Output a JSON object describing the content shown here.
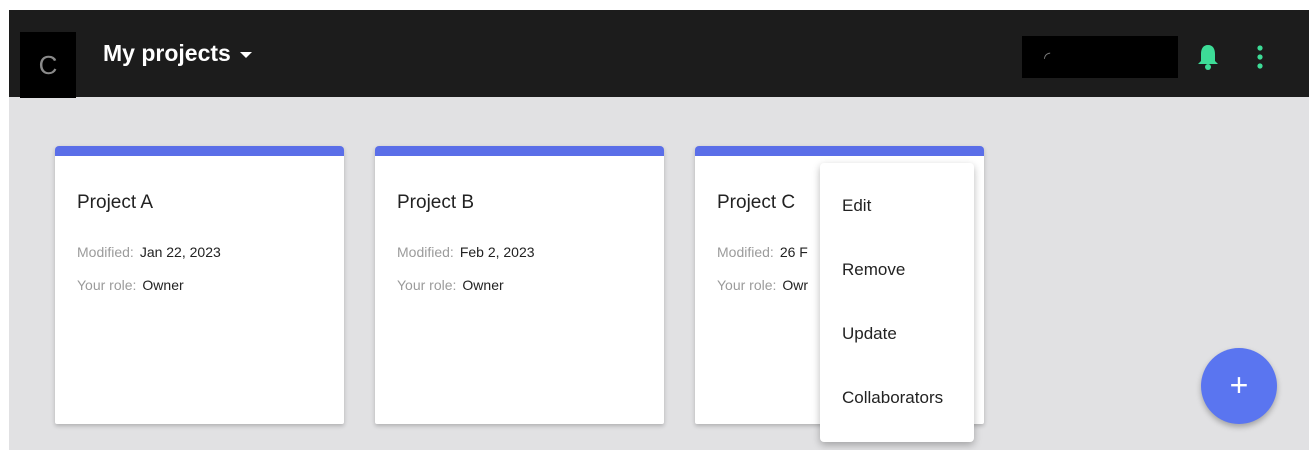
{
  "header": {
    "logo_letter": "C",
    "title": "My projects",
    "search_glyph": "◜",
    "bell_color": "#3ddc97"
  },
  "projects": [
    {
      "name": "Project A",
      "modified_label": "Modified:",
      "modified": "Jan 22, 2023",
      "role_label": "Your role:",
      "role": "Owner"
    },
    {
      "name": "Project B",
      "modified_label": "Modified:",
      "modified": "Feb 2, 2023",
      "role_label": "Your role:",
      "role": "Owner"
    },
    {
      "name": "Project C",
      "modified_label": "Modified:",
      "modified": "26 F",
      "role_label": "Your role:",
      "role": "Owr"
    }
  ],
  "context_menu": {
    "items": [
      "Edit",
      "Remove",
      "Update",
      "Collaborators"
    ]
  },
  "fab": {
    "glyph": "+"
  },
  "colors": {
    "accent": "#5a6ee8",
    "topbar": "#1c1c1c",
    "background": "#e1e1e3"
  }
}
